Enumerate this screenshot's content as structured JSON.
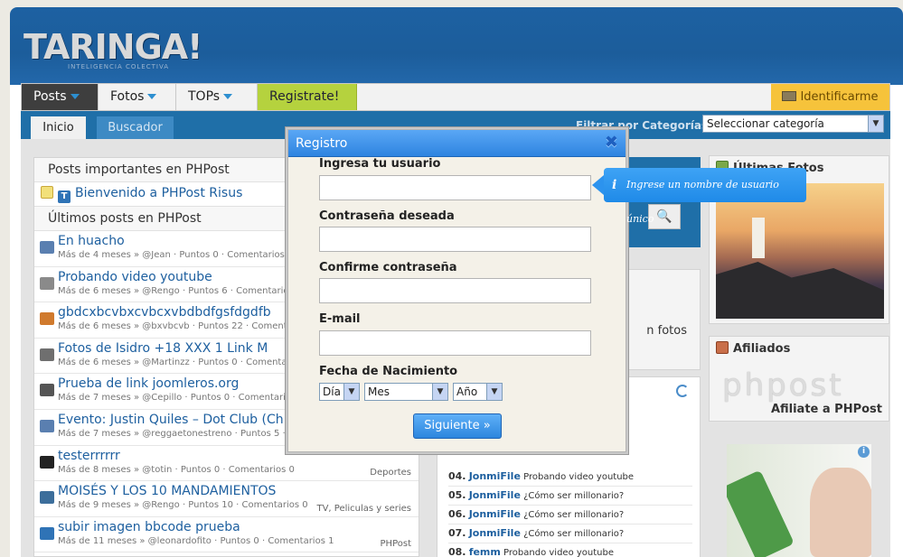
{
  "header": {
    "logo": "TARINGA!",
    "tagline": "INTELIGENCIA COLECTIVA"
  },
  "nav": {
    "posts": "Posts",
    "fotos": "Fotos",
    "tops": "TOPs",
    "registrate": "Registrate!",
    "identificarme": "Identificarme"
  },
  "subnav": {
    "inicio": "Inicio",
    "buscador": "Buscador",
    "filtrar_label": "Filtrar por Categorías:",
    "category_select": "Seleccionar categoría"
  },
  "left": {
    "important_title": "Posts importantes en PHPost",
    "pinned_post": "Bienvenido a PHPost Risus",
    "latest_title": "Últimos posts en PHPost",
    "posts": [
      {
        "title": "En huacho",
        "meta": "Más de 4 meses » @Jean · Puntos 0 · Comentarios 0",
        "cat": "",
        "icon_color": "#5a7fb0"
      },
      {
        "title": "Probando video youtube",
        "meta": "Más de 6 meses » @Rengo · Puntos 6 · Comentarios",
        "cat": "",
        "icon_color": "#8a8a8a"
      },
      {
        "title": "gbdcxbcvbxcvbcxvbdbdfgsfdgdfb",
        "meta": "Más de 6 meses » @bxvbcvb · Puntos 22 · Coment",
        "cat": "",
        "icon_color": "#d07a2d"
      },
      {
        "title": "Fotos de Isidro +18 XXX 1 Link M",
        "meta": "Más de 6 meses » @Martinzz · Puntos 0 · Comentar",
        "cat": "",
        "icon_color": "#6f6f6f"
      },
      {
        "title": "Prueba de link joomleros.org",
        "meta": "Más de 7 meses » @Cepillo · Puntos 0 · Comentarios",
        "cat": "",
        "icon_color": "#555555"
      },
      {
        "title": "Evento: Justin Quiles – Dot Club (Ch",
        "meta": "Más de 7 meses » @reggaetonestreno · Puntos 5 ·",
        "cat": "",
        "icon_color": "#5a7fb0"
      },
      {
        "title": "testerrrrrr",
        "meta": "Más de 8 meses » @totin · Puntos 0 · Comentarios 0",
        "cat": "Deportes",
        "icon_color": "#222222"
      },
      {
        "title": "MOISÉS Y LOS 10 MANDAMIENTOS",
        "meta": "Más de 9 meses » @Rengo · Puntos 10 · Comentarios 0",
        "cat": "TV, Peliculas y series",
        "icon_color": "#3c6e9b"
      },
      {
        "title": "subir imagen bbcode prueba",
        "meta": "Más de 11 meses » @leonardofito · Puntos 0 · Comentarios 1",
        "cat": "PHPost",
        "icon_color": "#2f73b6"
      }
    ]
  },
  "mid": {
    "fotos_text": "n fotos",
    "top": [
      {
        "n": "04.",
        "user": "JonmiFile",
        "title": "Probando video youtube"
      },
      {
        "n": "05.",
        "user": "JonmiFile",
        "title": "¿Cómo ser millonario?"
      },
      {
        "n": "06.",
        "user": "JonmiFile",
        "title": "¿Cómo ser millonario?"
      },
      {
        "n": "07.",
        "user": "JonmiFile",
        "title": "¿Cómo ser millonario?"
      },
      {
        "n": "08.",
        "user": "femm",
        "title": "Probando video youtube"
      }
    ]
  },
  "right": {
    "fotos_title": "Últimas Fotos",
    "afiliados_title": "Afiliados",
    "phpost_logo": "phpost",
    "afiliate": "Afiliate a PHPost"
  },
  "modal": {
    "title": "Registro",
    "close": "✖",
    "usuario_label": "Ingresa tu usuario",
    "usuario_value": "",
    "password_label": "Contraseña deseada",
    "confirm_label": "Confirme contraseña",
    "email_label": "E-mail",
    "birth_label": "Fecha de Nacimiento",
    "day": "Día",
    "month": "Mes",
    "year": "Año",
    "next": "Siguiente »"
  },
  "tooltip": {
    "icon": "i",
    "text": "Ingrese un nombre de usuario único"
  },
  "colors": {
    "brand_blue": "#1d61a2",
    "accent_green": "#b5d23e",
    "accent_yellow": "#f6c33b",
    "link": "#1d5f9f"
  }
}
